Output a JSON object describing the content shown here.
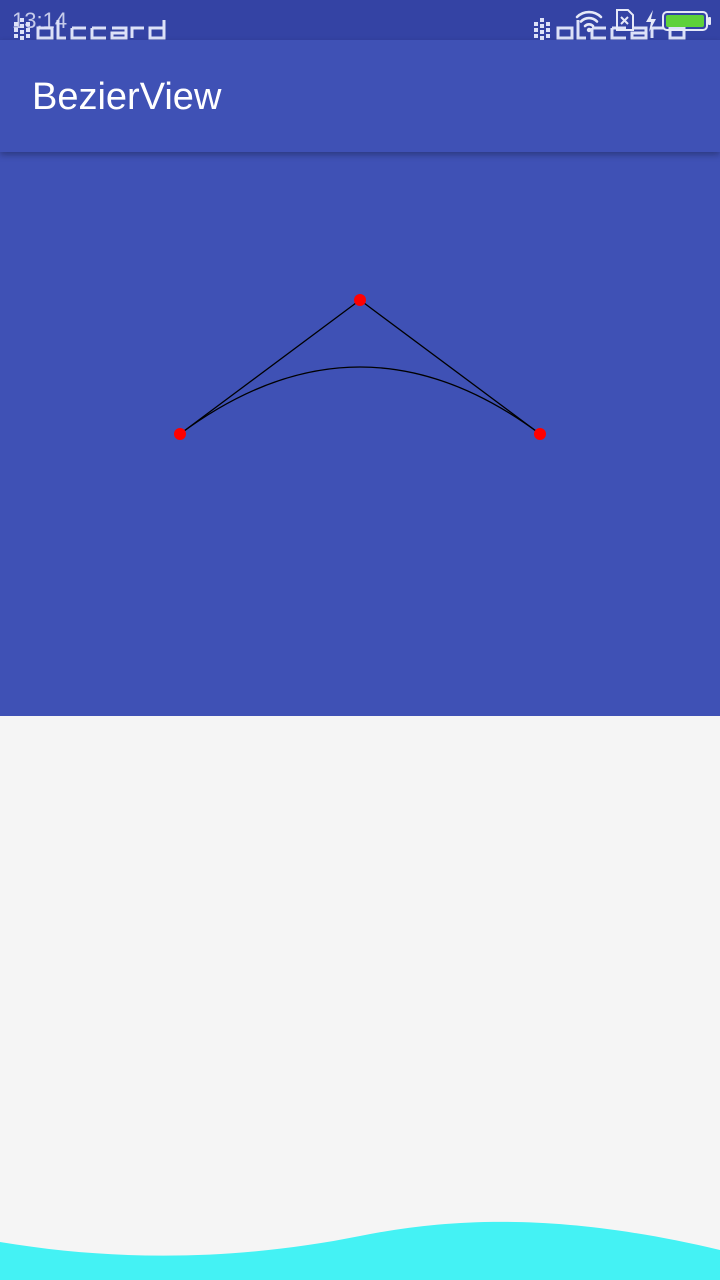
{
  "status_bar": {
    "time": "13:14",
    "watermark_left_icon": "dlccard-watermark",
    "watermark_right_icon": "dlccard-watermark",
    "icons": [
      "wifi-icon",
      "no-sim-icon",
      "charging-icon",
      "battery-icon"
    ]
  },
  "app_bar": {
    "title": "BezierView"
  },
  "bezier_view": {
    "background_color": "#3f51b5",
    "control_point_color": "#ff0000",
    "line_color": "#000000"
  },
  "wave": {
    "color": "#44f2f4"
  }
}
